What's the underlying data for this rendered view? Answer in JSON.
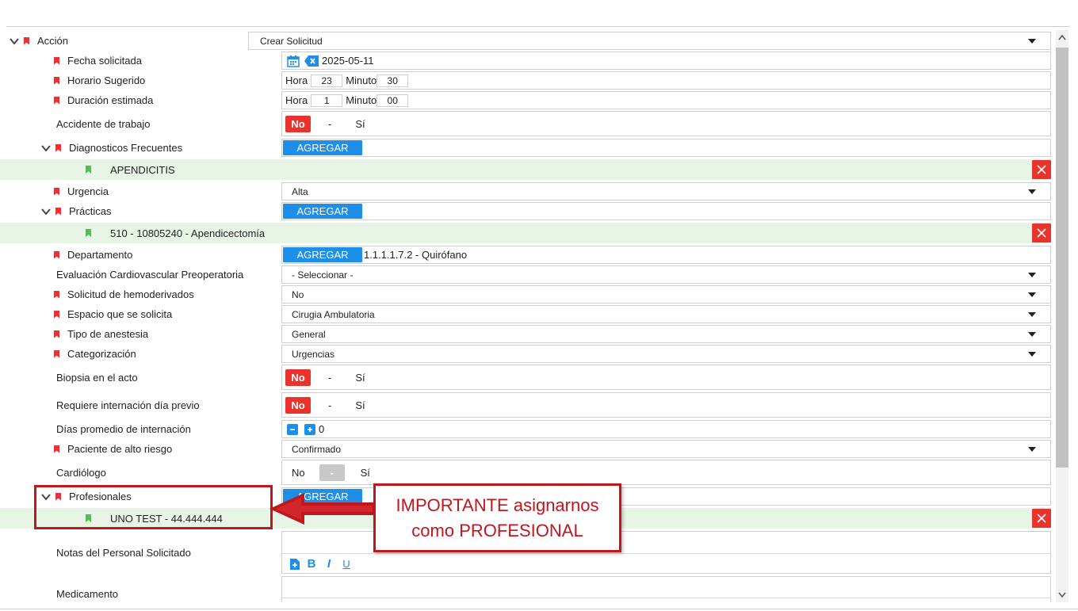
{
  "accion": {
    "label": "Acción",
    "value": "Crear Solicitud"
  },
  "fecha": {
    "label": "Fecha solicitada",
    "value": "2025-05-11"
  },
  "horario": {
    "label": "Horario Sugerido",
    "hora_label": "Hora",
    "hora": "23",
    "minuto_label": "Minuto",
    "minuto": "30"
  },
  "duracion": {
    "label": "Duración estimada",
    "hora_label": "Hora",
    "hora": "1",
    "minuto_label": "Minuto",
    "minuto": "00"
  },
  "accidente": {
    "label": "Accidente de trabajo",
    "no": "No",
    "sep": "-",
    "si": "Sí"
  },
  "diagnosticos": {
    "label": "Diagnosticos Frecuentes",
    "button": "AGREGAR",
    "items": [
      "APENDICITIS"
    ]
  },
  "urgencia": {
    "label": "Urgencia",
    "value": "Alta"
  },
  "practicas": {
    "label": "Prácticas",
    "button": "AGREGAR",
    "items": [
      "510 - 10805240 - Apendicectomía"
    ]
  },
  "departamento": {
    "label": "Departamento",
    "button": "AGREGAR",
    "value": "1.1.1.1.7.2 - Quirófano"
  },
  "evaluacion": {
    "label": "Evaluación Cardiovascular Preoperatoria",
    "value": "- Seleccionar -"
  },
  "hemoderivados": {
    "label": "Solicitud de hemoderivados",
    "value": "No"
  },
  "espacio": {
    "label": "Espacio que se solicita",
    "value": "Cirugia Ambulatoria"
  },
  "anestesia": {
    "label": "Tipo de anestesia",
    "value": "General"
  },
  "categorizacion": {
    "label": "Categorización",
    "value": "Urgencias"
  },
  "biopsia": {
    "label": "Biopsia en el acto",
    "no": "No",
    "sep": "-",
    "si": "Sí"
  },
  "internacion_previo": {
    "label": "Requiere internación día previo",
    "no": "No",
    "sep": "-",
    "si": "Sí"
  },
  "dias_internacion": {
    "label": "Días promedio de internación",
    "value": "0"
  },
  "alto_riesgo": {
    "label": "Paciente de alto riesgo",
    "value": "Confirmado"
  },
  "cardiologo": {
    "label": "Cardiólogo",
    "no": "No",
    "sep": "-",
    "si": "Sí"
  },
  "profesionales": {
    "label": "Profesionales",
    "button": "AGREGAR",
    "items": [
      "UNO TEST - 44.444.444"
    ]
  },
  "notas": {
    "label": "Notas del Personal Solicitado"
  },
  "medicamento": {
    "label": "Medicamento"
  },
  "callout": {
    "line1": "IMPORTANTE asignarnos",
    "line2": "como PROFESIONAL"
  },
  "colors": {
    "accent": "#1e8fe8",
    "danger": "#e9332d",
    "annotation": "#c0161d",
    "selected_row": "#e8f5e6"
  }
}
